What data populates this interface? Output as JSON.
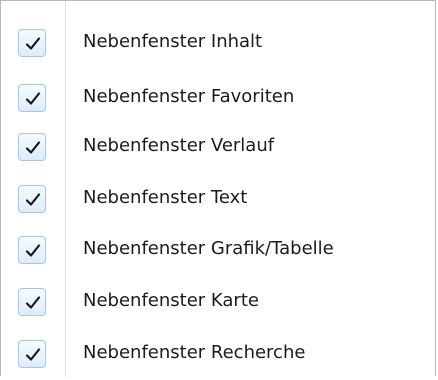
{
  "menu": {
    "items": [
      {
        "label": "Nebenfenster Inhalt",
        "checked": true,
        "icon": "checkmark-icon"
      },
      {
        "label": "Nebenfenster Favoriten",
        "checked": true,
        "icon": "checkmark-icon"
      },
      {
        "label": "Nebenfenster Verlauf",
        "checked": true,
        "icon": "checkmark-icon"
      },
      {
        "label": "Nebenfenster Text",
        "checked": true,
        "icon": "checkmark-icon"
      },
      {
        "label": "Nebenfenster Grafik/Tabelle",
        "checked": true,
        "icon": "checkmark-icon"
      },
      {
        "label": "Nebenfenster Karte",
        "checked": true,
        "icon": "checkmark-icon"
      },
      {
        "label": "Nebenfenster Recherche",
        "checked": true,
        "icon": "checkmark-icon"
      }
    ]
  },
  "colors": {
    "menu_border": "#b9b9b9",
    "gutter_line": "#e3e3e3",
    "checkbox_border": "#a7c5e6",
    "checkmark": "#1a1a1a",
    "text": "#1b1b1b"
  }
}
